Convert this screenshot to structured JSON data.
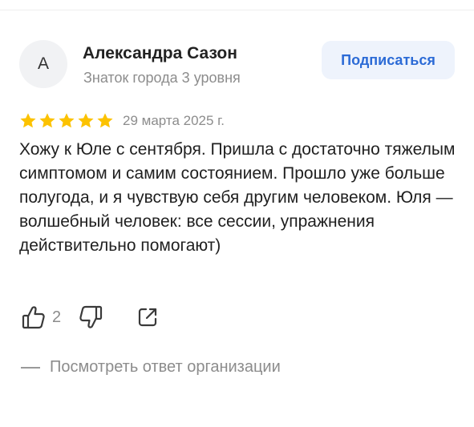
{
  "review": {
    "author": {
      "initial": "А",
      "name": "Александра Сазон",
      "level": "Знаток города 3 уровня"
    },
    "subscribe_label": "Подписаться",
    "rating": 5,
    "rating_max": 5,
    "date": "29 марта 2025 г.",
    "text": "Хожу к Юле с сентября. Пришла с достаточно тяжелым симптомом и самим состоянием. Прошло уже больше полугода, и я чувствую себя другим человеком. Юля — волшебный человек: все сессии, упражнения действительно помогают)",
    "likes": "2",
    "view_response_label": "Посмотреть ответ организации"
  },
  "colors": {
    "star": "#fcc200",
    "accent": "#2c6bd6",
    "subscribe_bg": "#eef3fc",
    "muted": "#8c8c8c",
    "icon": "#3a3a3a"
  },
  "icons": [
    "star-icon",
    "thumbs-up-icon",
    "thumbs-down-icon",
    "share-icon"
  ]
}
